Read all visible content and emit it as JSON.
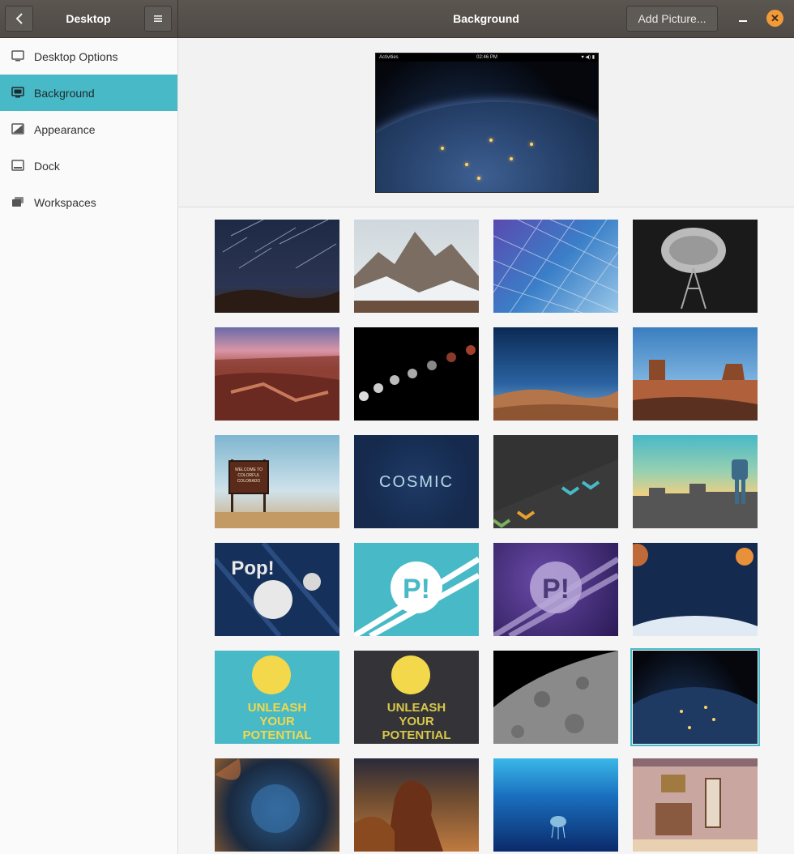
{
  "header": {
    "sidebar_title": "Desktop",
    "main_title": "Background",
    "add_picture_label": "Add Picture...",
    "back_icon": "chevron-left-icon",
    "menu_icon": "hamburger-icon"
  },
  "sidebar": {
    "items": [
      {
        "label": "Desktop Options",
        "icon": "monitor-icon",
        "active": false
      },
      {
        "label": "Background",
        "icon": "background-icon",
        "active": true
      },
      {
        "label": "Appearance",
        "icon": "appearance-icon",
        "active": false
      },
      {
        "label": "Dock",
        "icon": "dock-icon",
        "active": false
      },
      {
        "label": "Workspaces",
        "icon": "workspaces-icon",
        "active": false
      }
    ]
  },
  "preview": {
    "topbar_activities": "Activities",
    "topbar_clock": "02:46 PM",
    "topbar_sys": "♥ ◀) ▮"
  },
  "wallpapers": [
    {
      "name": "star-trails"
    },
    {
      "name": "snowy-mountains"
    },
    {
      "name": "geodesic-dome"
    },
    {
      "name": "radio-dish"
    },
    {
      "name": "grand-canyon"
    },
    {
      "name": "lunar-eclipse"
    },
    {
      "name": "desert-dunes"
    },
    {
      "name": "monument-valley"
    },
    {
      "name": "colorado-sign",
      "sign_text": "WELCOME TO COLORFUL COLORADO"
    },
    {
      "name": "cosmic",
      "text": "COSMIC"
    },
    {
      "name": "chevrons"
    },
    {
      "name": "robot-city"
    },
    {
      "name": "pop-moon",
      "text": "Pop!"
    },
    {
      "name": "pop-logo-teal"
    },
    {
      "name": "pop-logo-purple"
    },
    {
      "name": "planets"
    },
    {
      "name": "unleash-teal",
      "text": "UNLEASH YOUR POTENTIAL"
    },
    {
      "name": "unleash-dark",
      "text": "UNLEASH YOUR POTENTIAL"
    },
    {
      "name": "moon-surface"
    },
    {
      "name": "earth-night",
      "selected": true
    },
    {
      "name": "bubble-nebula"
    },
    {
      "name": "pillars-nebula"
    },
    {
      "name": "jellyfish"
    },
    {
      "name": "cartoon-room"
    }
  ],
  "colors": {
    "accent": "#48b9c7",
    "close": "#f29a38",
    "header": "#55504b"
  }
}
